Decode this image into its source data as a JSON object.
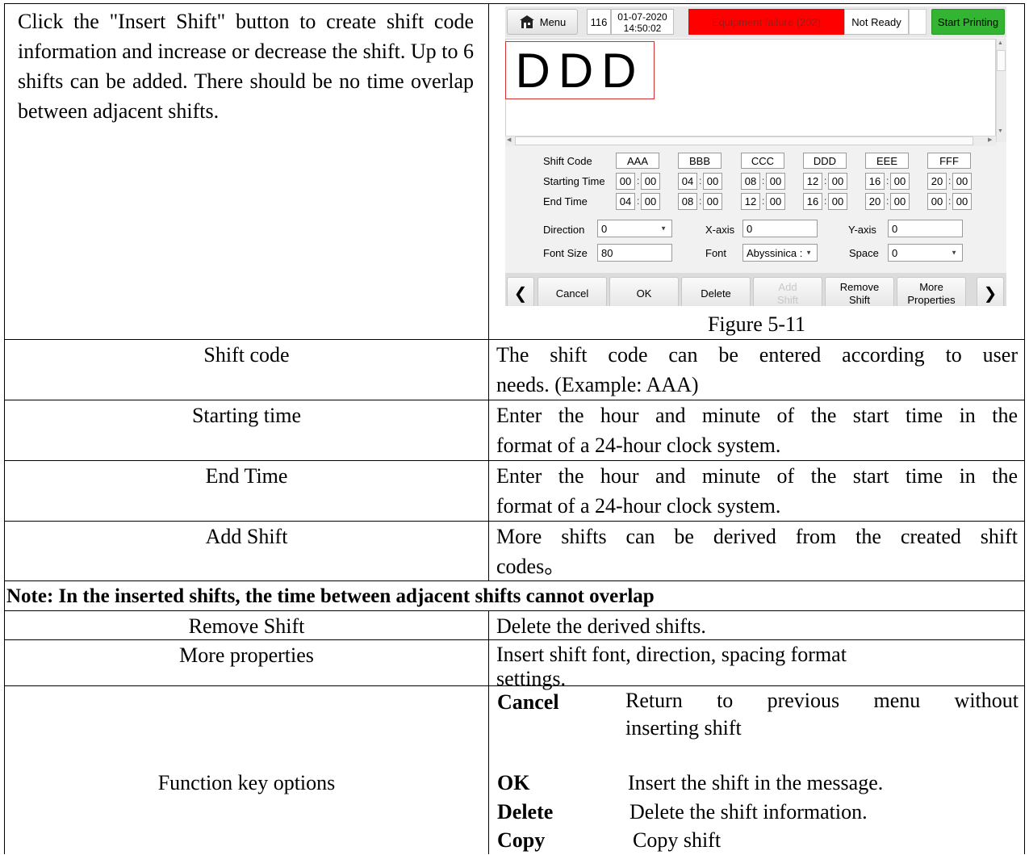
{
  "intro": {
    "text": "Click the \"Insert Shift\" button to create shift code information and increase or decrease the shift. Up to 6 shifts can be added. There should be no time overlap between adjacent shifts."
  },
  "screen": {
    "menu_label": "Menu",
    "counter": "116",
    "date": "01-07-2020",
    "time": "14:50:02",
    "alert": "Equipment failure (202)",
    "status": "Not Ready",
    "start_label": "Start Printing",
    "preview_text": "DDD",
    "shift_code_label": "Shift Code",
    "starting_time_label": "Starting Time",
    "end_time_label": "End Time",
    "shifts": [
      {
        "code": "AAA",
        "start_h": "00",
        "start_m": "00",
        "end_h": "04",
        "end_m": "00"
      },
      {
        "code": "BBB",
        "start_h": "04",
        "start_m": "00",
        "end_h": "08",
        "end_m": "00"
      },
      {
        "code": "CCC",
        "start_h": "08",
        "start_m": "00",
        "end_h": "12",
        "end_m": "00"
      },
      {
        "code": "DDD",
        "start_h": "12",
        "start_m": "00",
        "end_h": "16",
        "end_m": "00"
      },
      {
        "code": "EEE",
        "start_h": "16",
        "start_m": "00",
        "end_h": "20",
        "end_m": "00"
      },
      {
        "code": "FFF",
        "start_h": "20",
        "start_m": "00",
        "end_h": "00",
        "end_m": "00"
      }
    ],
    "direction_label": "Direction",
    "direction_value": "0",
    "xaxis_label": "X-axis",
    "xaxis_value": "0",
    "yaxis_label": "Y-axis",
    "yaxis_value": "0",
    "fontsize_label": "Font Size",
    "fontsize_value": "80",
    "font_label": "Font",
    "font_value": "Abyssinica :",
    "space_label": "Space",
    "space_value": "0",
    "buttons": {
      "cancel": "Cancel",
      "ok": "OK",
      "delete": "Delete",
      "add_shift": [
        "Add",
        "Shift"
      ],
      "remove_shift": [
        "Remove",
        "Shift"
      ],
      "more_properties": [
        "More",
        "Properties"
      ]
    },
    "colors": {
      "alert_bg": "#ff0000",
      "start_bg": "#33b533",
      "preview_border": "#d03030"
    }
  },
  "figure_caption": "Figure 5-11",
  "rows": [
    {
      "term": "Shift code",
      "desc": [
        "The shift code can be entered according to user",
        "needs. (Example: AAA)"
      ]
    },
    {
      "term": "Starting time",
      "desc": [
        "Enter the hour and minute of the start time in the",
        "format of a 24-hour clock system."
      ]
    },
    {
      "term": "End Time",
      "desc": [
        "Enter the hour and minute of the start time in the",
        "format of a 24-hour clock system."
      ]
    },
    {
      "term": "Add Shift",
      "desc": [
        "More shifts can be derived from the created shift",
        "codes。"
      ]
    }
  ],
  "note": "Note: In the inserted shifts, the time between adjacent shifts cannot overlap",
  "rows2": [
    {
      "term": "Remove Shift",
      "desc": [
        "Delete the derived shifts."
      ]
    },
    {
      "term": "More properties",
      "desc": [
        "Insert shift font, direction, spacing format",
        "settings."
      ]
    }
  ],
  "function_keys": {
    "term": "Function key options",
    "items": [
      {
        "key": "Cancel",
        "desc": [
          "Return to previous menu without",
          "inserting shift"
        ]
      },
      {
        "key": "OK",
        "desc": [
          "Insert the shift in the message."
        ]
      },
      {
        "key": "Delete",
        "desc": [
          "Delete the shift information."
        ]
      },
      {
        "key": "Copy",
        "desc": [
          "Copy shift"
        ]
      }
    ]
  }
}
